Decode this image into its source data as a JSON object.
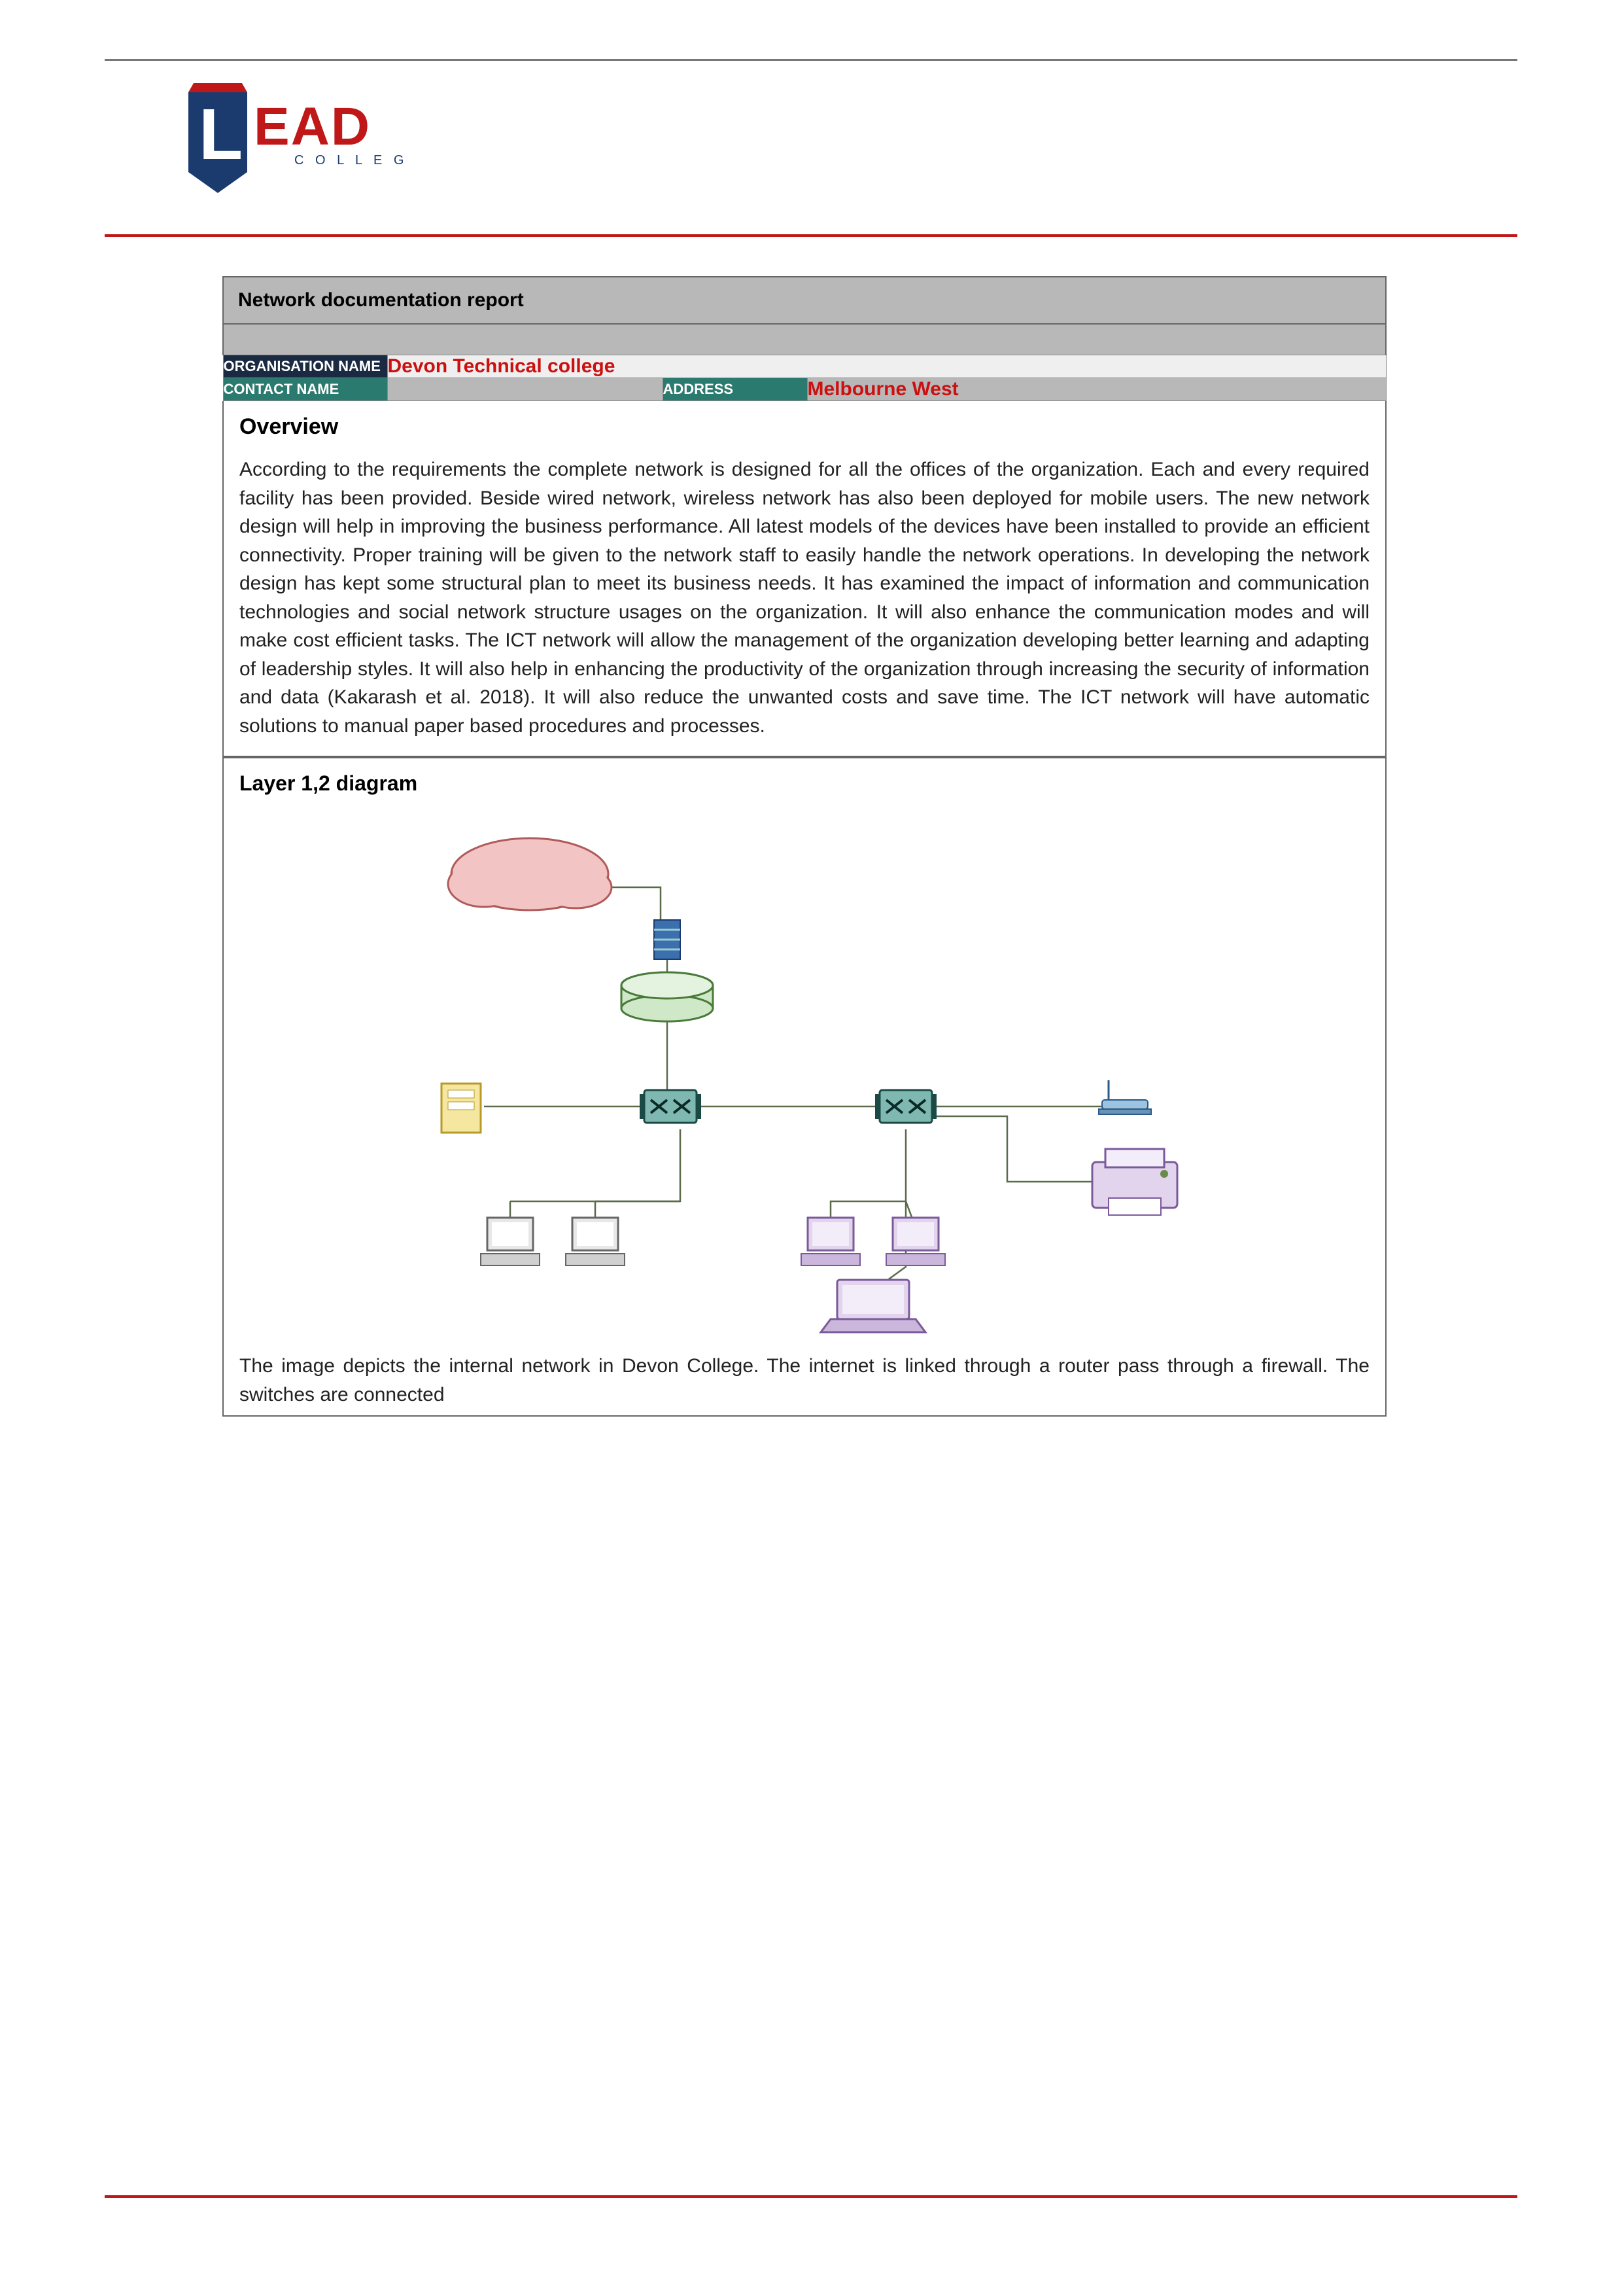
{
  "logo": {
    "brand_letters": "EAD",
    "brand_first": "L",
    "subtitle": "C O L L E G E"
  },
  "report": {
    "title": "Network documentation report",
    "org_label": "ORGANISATION NAME",
    "org_value": "Devon Technical college",
    "contact_label": "CONTACT NAME",
    "contact_value": "",
    "address_label": "ADDRESS",
    "address_value": "Melbourne West"
  },
  "overview": {
    "heading": "Overview",
    "body": "According to the requirements the complete network is designed for all the offices of the organization. Each and every required facility has been provided. Beside wired network, wireless network has also been deployed for mobile users. The new network design will help in improving the business performance. All latest models of the devices have been installed to provide an efficient connectivity. Proper training will be given to the network staff to easily handle the network operations. In developing the network design has kept some structural plan to meet its business needs. It has examined the impact of information and communication technologies and social network structure usages on the organization. It will also enhance the communication modes and will make cost efficient tasks. The ICT network will allow the management of the organization developing better learning and adapting of leadership styles. It will also help in enhancing the productivity of the organization through increasing the security of information and data (Kakarash et al. 2018). It will also reduce the unwanted costs and save time. The ICT network will have automatic solutions to manual paper based procedures and processes."
  },
  "diagram": {
    "heading": "Layer 1,2 diagram",
    "caption": "The image depicts the internal network in Devon College. The internet is linked through a router pass through a firewall. The switches are connected",
    "nodes": {
      "cloud": "Internet cloud",
      "server": "Server rack",
      "router": "Router",
      "fileserver": "File server",
      "switch1": "Switch 1",
      "switch2": "Switch 2",
      "ap": "Wireless AP",
      "pc1": "Desktop PC",
      "pc2": "Desktop PC",
      "pc3": "Desktop PC",
      "pc4": "Desktop PC",
      "laptop": "Laptop",
      "printer": "Printer"
    }
  }
}
